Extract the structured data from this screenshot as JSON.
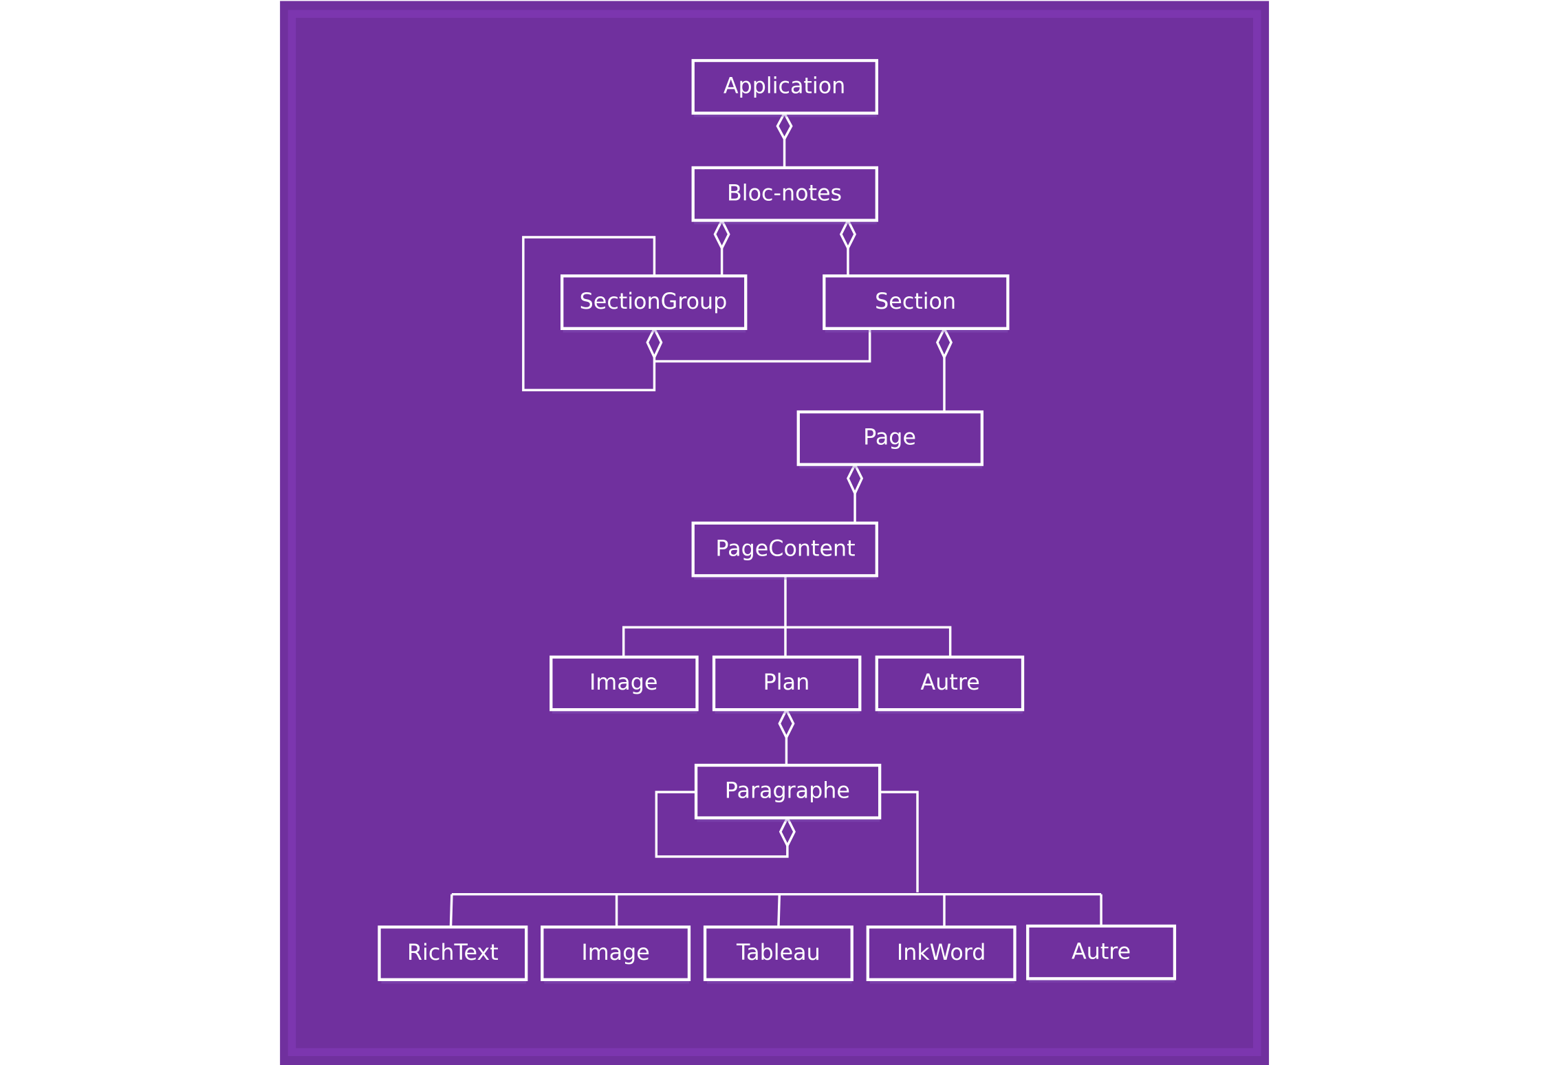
{
  "diagram": {
    "title": "",
    "background_color": "#70309e",
    "line_color": "#ffffff",
    "nodes": {
      "application": "Application",
      "bloc_notes": "Bloc-notes",
      "section_group": "SectionGroup",
      "section": "Section",
      "page": "Page",
      "page_content": "PageContent",
      "image1": "Image",
      "plan": "Plan",
      "autre1": "Autre",
      "paragraphe": "Paragraphe",
      "richtext": "RichText",
      "image2": "Image",
      "tableau": "Tableau",
      "inkword": "InkWord",
      "autre2": "Autre"
    },
    "relations": [
      {
        "from": "Bloc-notes",
        "to": "Application",
        "type": "aggregation"
      },
      {
        "from": "SectionGroup",
        "to": "Bloc-notes",
        "type": "aggregation"
      },
      {
        "from": "Section",
        "to": "Bloc-notes",
        "type": "aggregation"
      },
      {
        "from": "SectionGroup",
        "to": "SectionGroup",
        "type": "aggregation"
      },
      {
        "from": "Section",
        "to": "SectionGroup",
        "type": "aggregation"
      },
      {
        "from": "Page",
        "to": "Section",
        "type": "aggregation"
      },
      {
        "from": "PageContent",
        "to": "Page",
        "type": "aggregation"
      },
      {
        "from": "Image",
        "to": "PageContent",
        "type": "generalization"
      },
      {
        "from": "Plan",
        "to": "PageContent",
        "type": "generalization"
      },
      {
        "from": "Autre",
        "to": "PageContent",
        "type": "generalization"
      },
      {
        "from": "Paragraphe",
        "to": "Plan",
        "type": "aggregation"
      },
      {
        "from": "Paragraphe",
        "to": "Paragraphe",
        "type": "aggregation"
      },
      {
        "from": "RichText",
        "to": "Paragraphe",
        "type": "generalization"
      },
      {
        "from": "Image",
        "to": "Paragraphe",
        "type": "generalization"
      },
      {
        "from": "Tableau",
        "to": "Paragraphe",
        "type": "generalization"
      },
      {
        "from": "InkWord",
        "to": "Paragraphe",
        "type": "generalization"
      },
      {
        "from": "Autre",
        "to": "Paragraphe",
        "type": "generalization"
      }
    ]
  }
}
